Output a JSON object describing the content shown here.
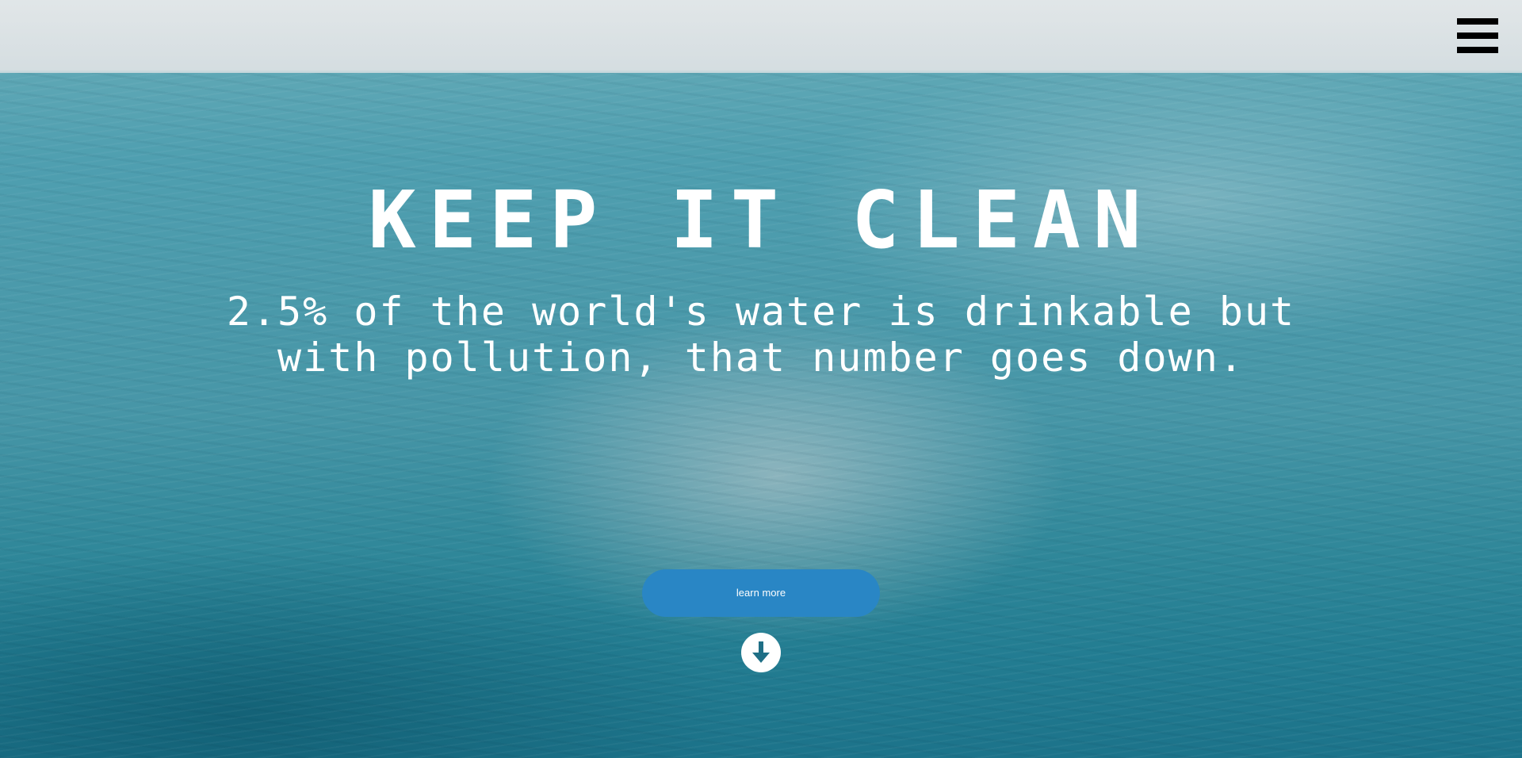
{
  "hero": {
    "headline": "KEEP IT CLEAN",
    "subtitle": "2.5% of the world's water is drinkable but with pollution, that number goes down."
  },
  "actions": {
    "learn_more_label": "learn more"
  },
  "icons": {
    "menu": "hamburger-menu-icon",
    "scroll": "arrow-down-circle-icon"
  },
  "colors": {
    "button": "#2986c5",
    "text": "#ffffff",
    "menu_bars": "#000000"
  }
}
